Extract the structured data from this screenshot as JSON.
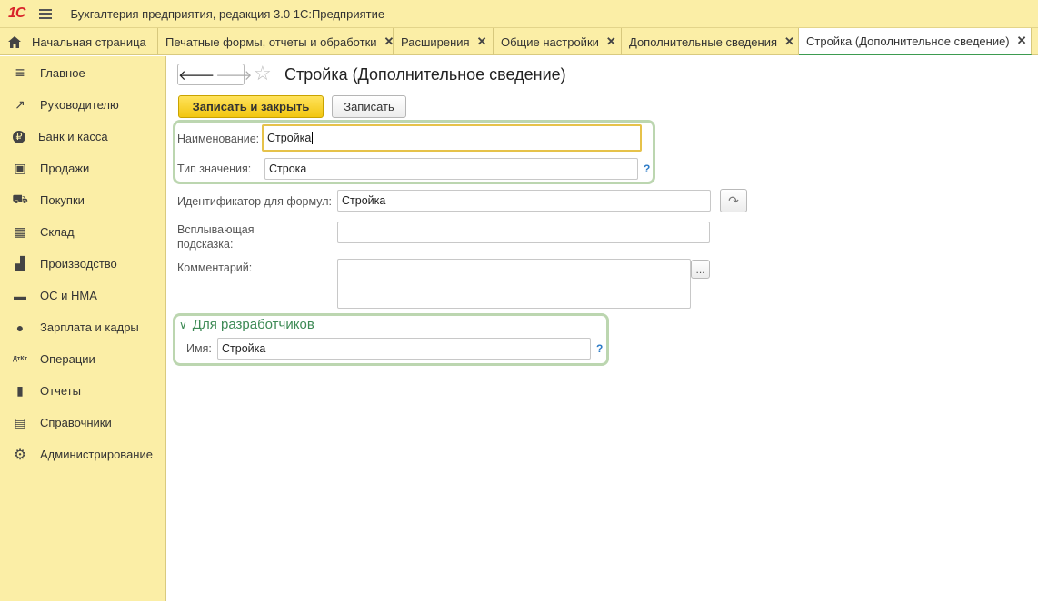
{
  "app": {
    "logo": "1С",
    "title": "Бухгалтерия предприятия, редакция 3.0 1С:Предприятие"
  },
  "tabs": [
    {
      "label": "Начальная страница"
    },
    {
      "label": "Печатные формы, отчеты и обработки"
    },
    {
      "label": "Расширения"
    },
    {
      "label": "Общие настройки"
    },
    {
      "label": "Дополнительные сведения"
    },
    {
      "label": "Стройка (Дополнительное сведение)"
    }
  ],
  "tab_close": "✕",
  "sidebar": {
    "items": [
      {
        "label": "Главное",
        "icon": "≡"
      },
      {
        "label": "Руководителю",
        "icon": "↗"
      },
      {
        "label": "Банк и касса",
        "icon": "₽"
      },
      {
        "label": "Продажи",
        "icon": "▣"
      },
      {
        "label": "Покупки",
        "icon": "⛟"
      },
      {
        "label": "Склад",
        "icon": "▦"
      },
      {
        "label": "Производство",
        "icon": "▟"
      },
      {
        "label": "ОС и НМА",
        "icon": "▬"
      },
      {
        "label": "Зарплата и кадры",
        "icon": "●"
      },
      {
        "label": "Операции",
        "icon": "ДтКт"
      },
      {
        "label": "Отчеты",
        "icon": "▮"
      },
      {
        "label": "Справочники",
        "icon": "▤"
      },
      {
        "label": "Администрирование",
        "icon": "⚙"
      }
    ]
  },
  "form": {
    "back": "🡐",
    "forward": "🡒",
    "star": "☆",
    "title": "Стройка (Дополнительное сведение)",
    "save_close_label": "Записать и закрыть",
    "save_label": "Записать",
    "name_label": "Наименование:",
    "name_value": "Стройка",
    "type_label": "Тип значения:",
    "type_value": "Строка",
    "formula_id_label": "Идентификатор для формул:",
    "formula_id_value": "Стройка",
    "tooltip_label_1": "Всплывающая",
    "tooltip_label_2": "подсказка:",
    "tooltip_value": "",
    "comment_label": "Комментарий:",
    "comment_value": "",
    "ellipsis": "...",
    "help": "?",
    "refresh_icon": "↷",
    "dev_section_label": "Для разработчиков",
    "dev_chevron": "∨",
    "dev_name_label": "Имя:",
    "dev_name_value": "Стройка"
  }
}
